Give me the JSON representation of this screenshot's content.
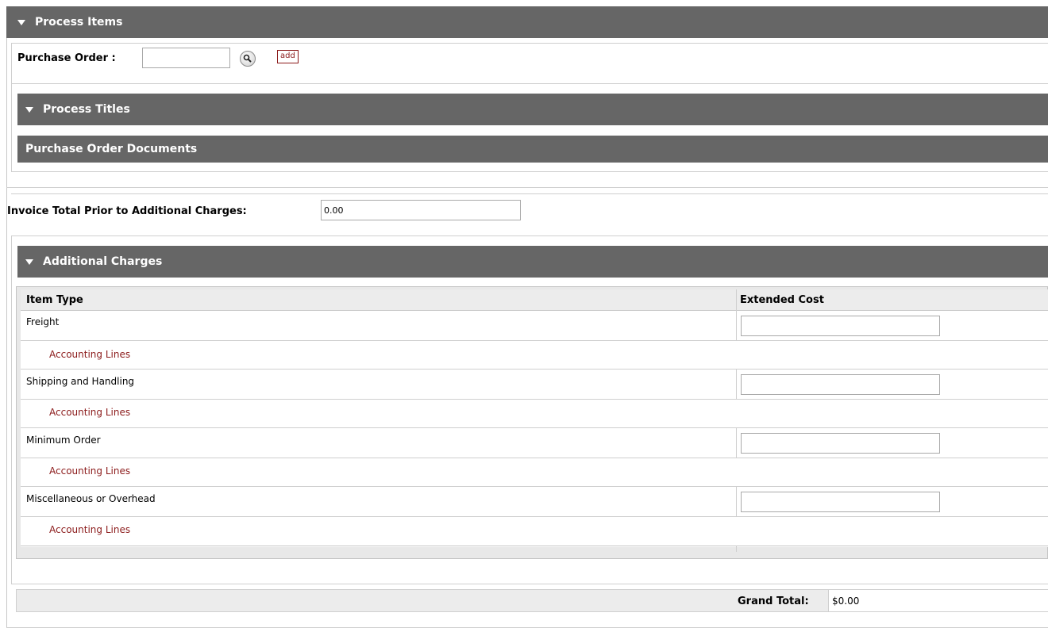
{
  "process_items": {
    "title": "Process Items",
    "purchase_order_label": "Purchase Order :",
    "purchase_order_value": "",
    "add_label": "add"
  },
  "process_titles": {
    "title": "Process Titles",
    "subheader": "Purchase Order Documents"
  },
  "invoice": {
    "label": "Invoice Total Prior to Additional Charges:",
    "value": "0.00"
  },
  "additional_charges": {
    "title": "Additional Charges",
    "col_item_type": "Item Type",
    "col_extended_cost": "Extended Cost",
    "rows": [
      {
        "item_type": "Freight",
        "cost": "",
        "link": "Accounting Lines"
      },
      {
        "item_type": "Shipping and Handling",
        "cost": "",
        "link": "Accounting Lines"
      },
      {
        "item_type": "Minimum Order",
        "cost": "",
        "link": "Accounting Lines"
      },
      {
        "item_type": "Miscellaneous or Overhead",
        "cost": "",
        "link": "Accounting Lines"
      }
    ]
  },
  "totals": {
    "grand_total_label": "Grand Total:",
    "grand_total_value": "$0.00"
  },
  "colors": {
    "header_bg": "#666666",
    "link": "#8b1a1a"
  },
  "icons": {
    "collapse": "triangle-down-icon",
    "search": "magnifier-icon"
  }
}
